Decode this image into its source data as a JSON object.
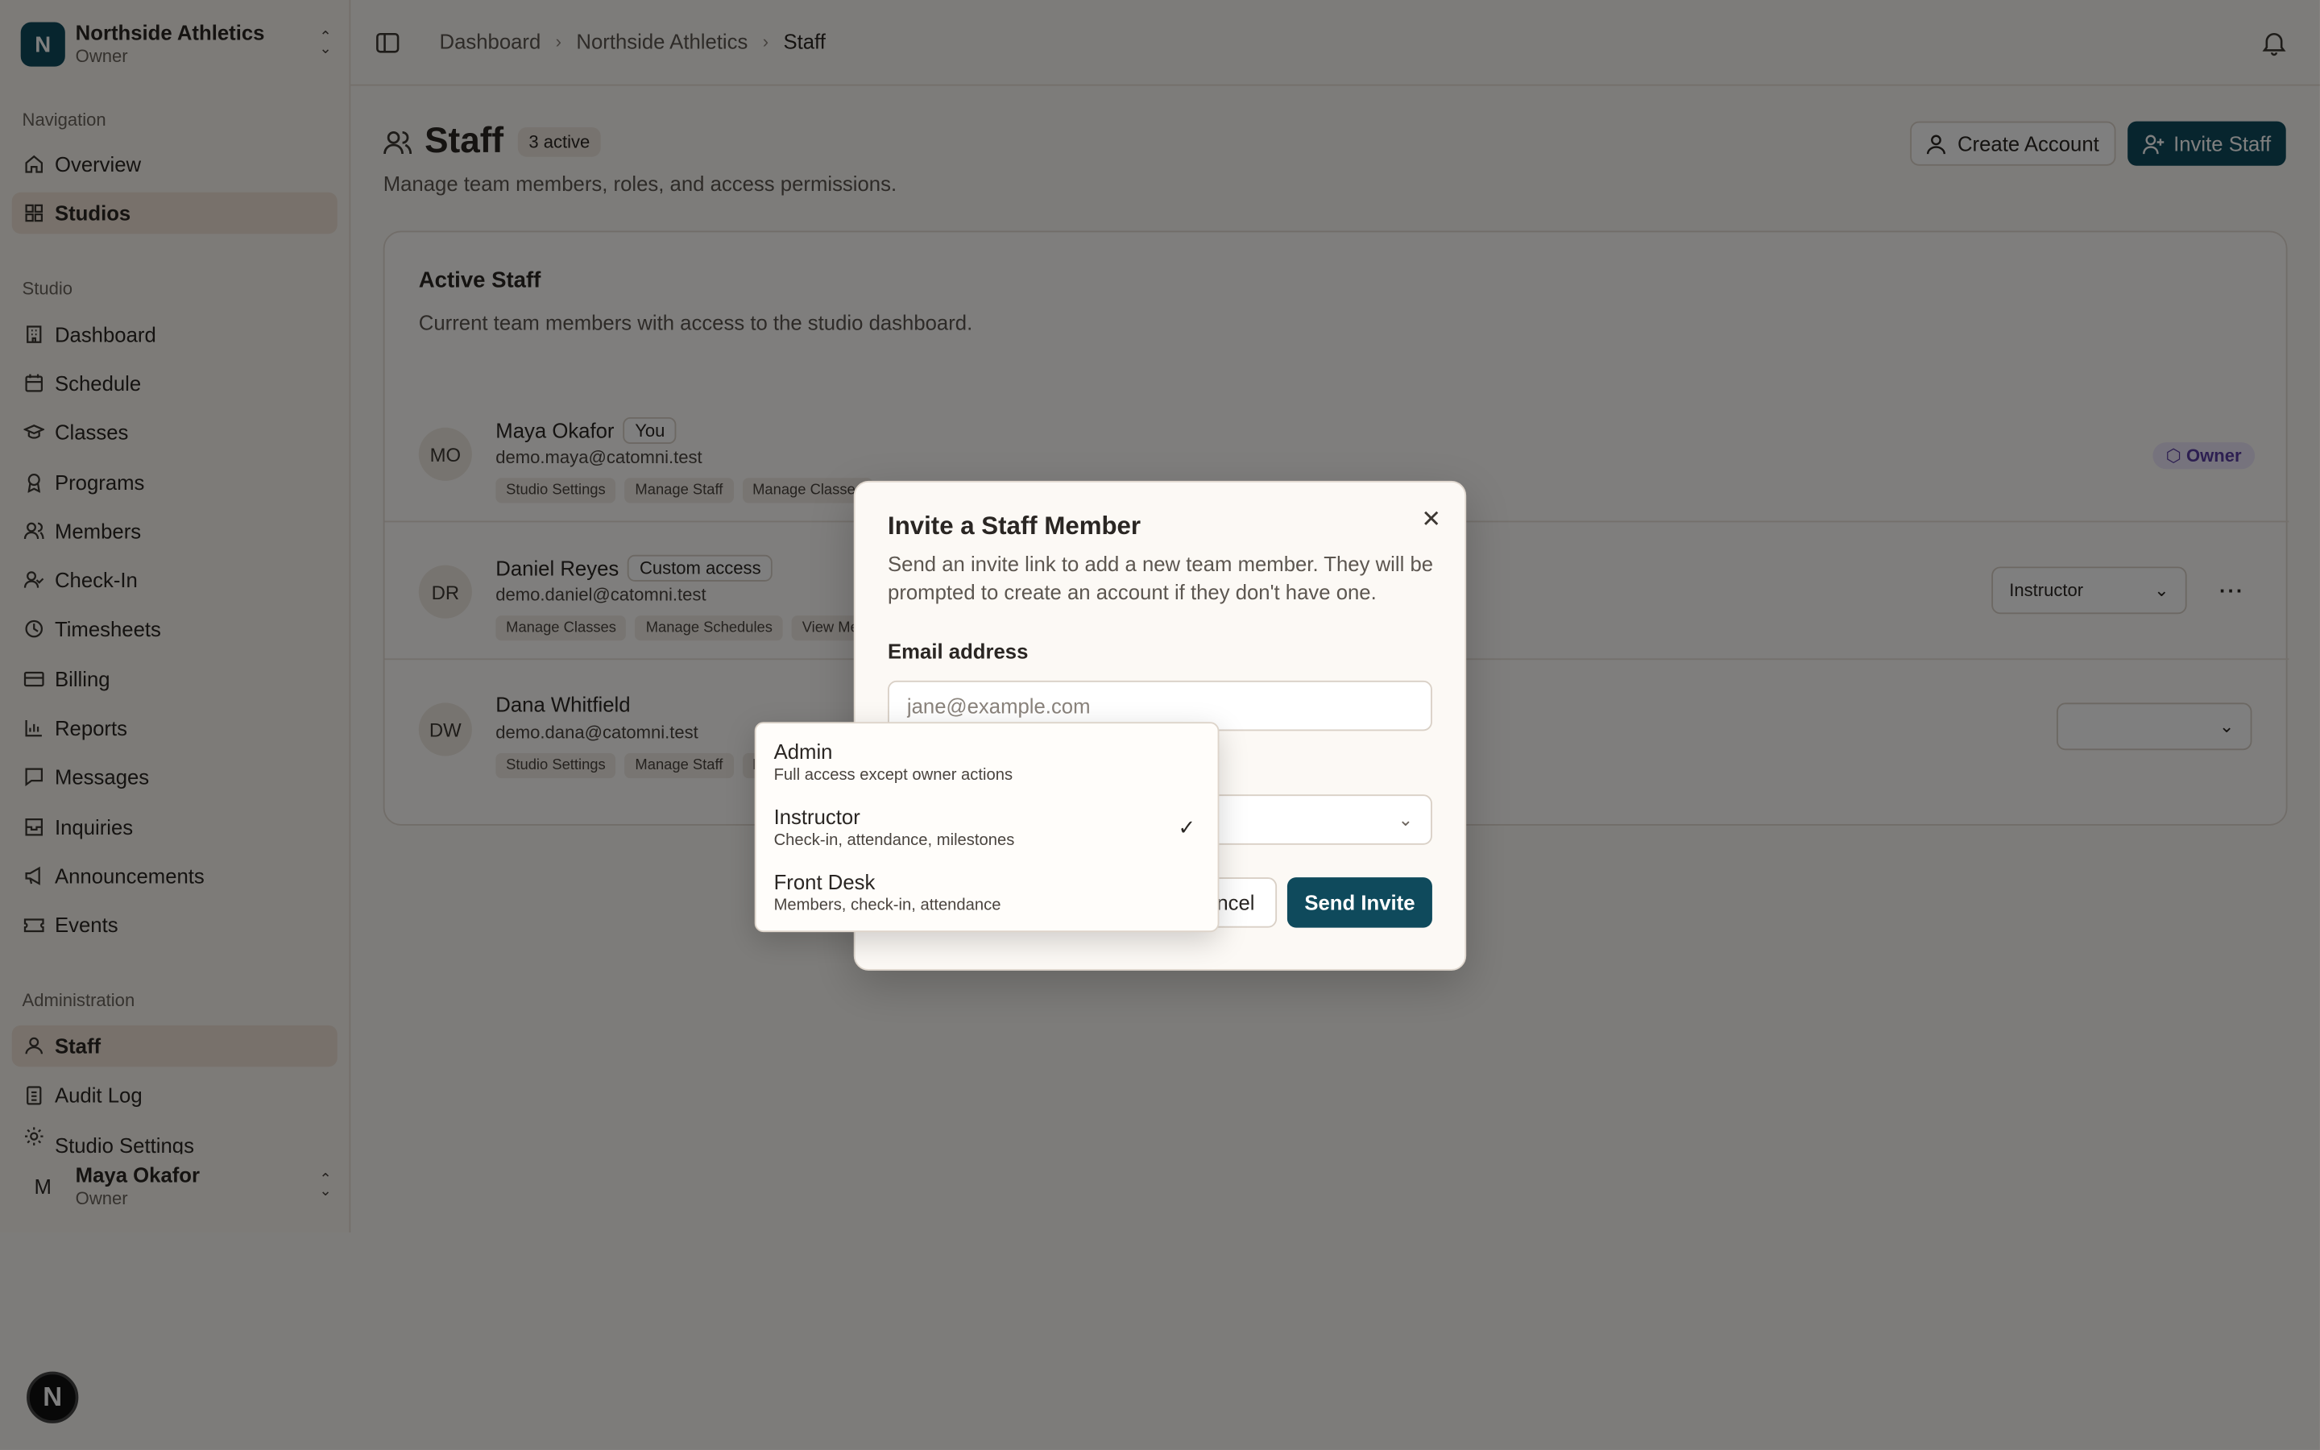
{
  "org": {
    "name": "Northside Athletics",
    "role": "Owner",
    "initial": "N"
  },
  "sidebar": {
    "nav_title": "Navigation",
    "nav_items": [
      {
        "label": "Overview",
        "icon": "home-icon"
      },
      {
        "label": "Studios",
        "icon": "grid-icon"
      }
    ],
    "studio_title": "Studio",
    "studio_items": [
      {
        "label": "Dashboard",
        "icon": "building-icon"
      },
      {
        "label": "Schedule",
        "icon": "calendar-icon"
      },
      {
        "label": "Classes",
        "icon": "graduation-cap-icon"
      },
      {
        "label": "Programs",
        "icon": "ribbon-icon"
      },
      {
        "label": "Members",
        "icon": "users-icon"
      },
      {
        "label": "Check-In",
        "icon": "user-check-icon"
      },
      {
        "label": "Timesheets",
        "icon": "clock-icon"
      },
      {
        "label": "Billing",
        "icon": "credit-card-icon"
      },
      {
        "label": "Reports",
        "icon": "bar-chart-icon"
      },
      {
        "label": "Messages",
        "icon": "message-icon"
      },
      {
        "label": "Inquiries",
        "icon": "inbox-icon"
      },
      {
        "label": "Announcements",
        "icon": "megaphone-icon"
      },
      {
        "label": "Events",
        "icon": "ticket-icon"
      }
    ],
    "admin_title": "Administration",
    "admin_items": [
      {
        "label": "Staff",
        "icon": "user-icon"
      },
      {
        "label": "Audit Log",
        "icon": "clipboard-icon"
      },
      {
        "label": "Studio Settings",
        "icon": "gear-icon"
      }
    ]
  },
  "user": {
    "name": "Maya Okafor",
    "role": "Owner",
    "initial": "M"
  },
  "breadcrumb": [
    "Dashboard",
    "Northside Athletics",
    "Staff"
  ],
  "page": {
    "title": "Staff",
    "count_badge": "3 active",
    "subtitle": "Manage team members, roles, and access permissions.",
    "create_account_label": "Create Account",
    "invite_staff_label": "Invite Staff"
  },
  "card": {
    "title": "Active Staff",
    "subtitle": "Current team members with access to the studio dashboard."
  },
  "staff": [
    {
      "initials": "MO",
      "name": "Maya Okafor",
      "badge": "You",
      "email": "demo.maya@catomni.test",
      "perms": [
        "Studio Settings",
        "Manage Staff",
        "Manage Classes"
      ],
      "role_badge": "Owner"
    },
    {
      "initials": "DR",
      "name": "Daniel Reyes",
      "badge": "Custom access",
      "email": "demo.daniel@catomni.test",
      "perms": [
        "Manage Classes",
        "Manage Schedules",
        "View Mem"
      ],
      "role_select": "Instructor"
    },
    {
      "initials": "DW",
      "name": "Dana Whitfield",
      "badge": "",
      "email": "demo.dana@catomni.test",
      "perms": [
        "Studio Settings",
        "Manage Staff",
        "M"
      ],
      "role_select": ""
    }
  ],
  "modal": {
    "title": "Invite a Staff Member",
    "description": "Send an invite link to add a new team member. They will be prompted to create an account if they don't have one.",
    "email_label": "Email address",
    "email_placeholder": "jane@example.com",
    "cancel_label": "ncel",
    "send_label": "Send Invite"
  },
  "role_options": [
    {
      "title": "Admin",
      "desc": "Full access except owner actions",
      "selected": false
    },
    {
      "title": "Instructor",
      "desc": "Check-in, attendance, milestones",
      "selected": true
    },
    {
      "title": "Front Desk",
      "desc": "Members, check-in, attendance",
      "selected": false
    }
  ],
  "colors": {
    "primary": "#0f4a5c",
    "active_nav": "#f0e3d6",
    "owner_badge": "#5b3ea3"
  }
}
